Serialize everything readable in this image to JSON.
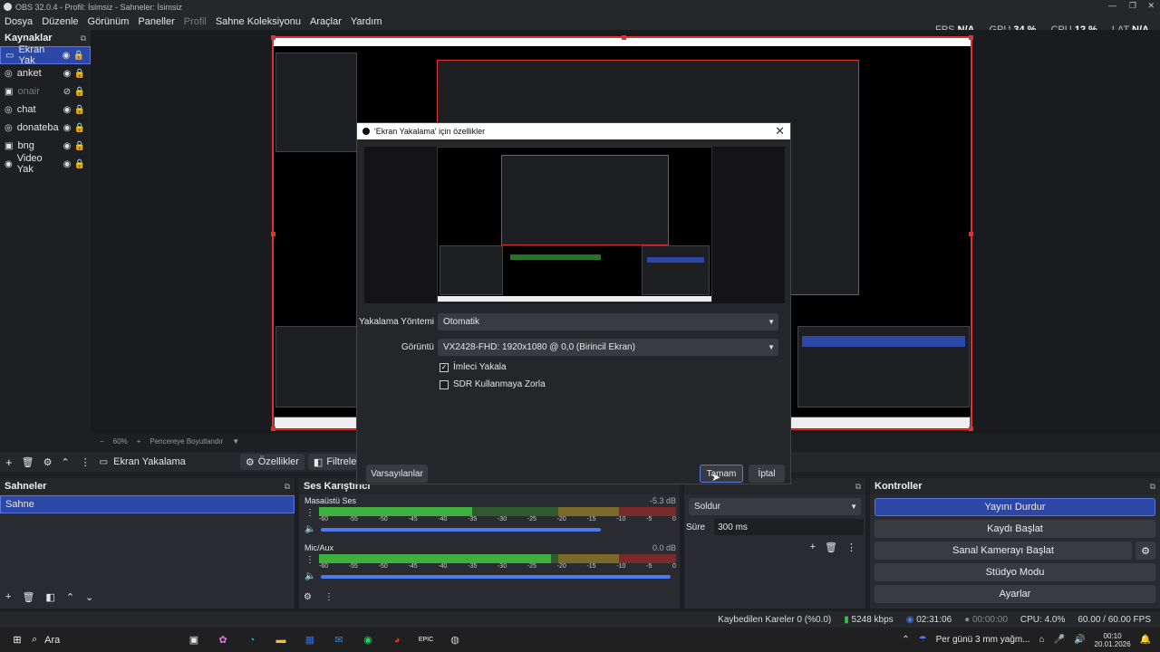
{
  "window": {
    "title": "OBS 32.0.4 - Profil: İsimsiz - Sahneler: İsimsiz"
  },
  "menu": [
    {
      "label": "Dosya",
      "disabled": false
    },
    {
      "label": "Düzenle",
      "disabled": false
    },
    {
      "label": "Görünüm",
      "disabled": false
    },
    {
      "label": "Paneller",
      "disabled": false
    },
    {
      "label": "Profil",
      "disabled": true
    },
    {
      "label": "Sahne Koleksiyonu",
      "disabled": false
    },
    {
      "label": "Araçlar",
      "disabled": false
    },
    {
      "label": "Yardım",
      "disabled": false
    }
  ],
  "stats": {
    "fps_label": "FPS",
    "fps": "N/A",
    "gpu_label": "GPU",
    "gpu": "34 %",
    "cpu_label": "CPU",
    "cpu": "12 %",
    "lat_label": "LAT",
    "lat": "N/A"
  },
  "sources": {
    "title": "Kaynaklar",
    "items": [
      {
        "label": "Ekran Yak",
        "icon": "monitor-icon",
        "visible": true,
        "selected": true
      },
      {
        "label": "anket",
        "icon": "browser-icon",
        "visible": true,
        "selected": false
      },
      {
        "label": "onair",
        "icon": "image-icon",
        "visible": false,
        "selected": false
      },
      {
        "label": "chat",
        "icon": "browser-icon",
        "visible": true,
        "selected": false
      },
      {
        "label": "donateba",
        "icon": "browser-icon",
        "visible": true,
        "selected": false
      },
      {
        "label": "bng",
        "icon": "image-icon",
        "visible": true,
        "selected": false
      },
      {
        "label": "Video Yak",
        "icon": "camera-icon",
        "visible": true,
        "selected": false
      }
    ]
  },
  "preview": {
    "zoom": "60%",
    "fit_label": "Pencereye Boyutlandır"
  },
  "source_toolbar": {
    "current": "Ekran Yakalama",
    "properties": "Özellikler",
    "filters": "Filtreler"
  },
  "scenes": {
    "title": "Sahneler",
    "items": [
      "Sahne"
    ]
  },
  "mixer": {
    "title": "Ses Karıştırıcı",
    "channels": [
      {
        "name": "Masaüstü Ses",
        "db": "-5.3 dB",
        "level": 0.43,
        "volume": 0.8
      },
      {
        "name": "Mic/Aux",
        "db": "0.0 dB",
        "level": 0.65,
        "volume": 1.0
      }
    ],
    "ticks": [
      "-60",
      "-55",
      "-50",
      "-45",
      "-40",
      "-35",
      "-30",
      "-25",
      "-20",
      "-15",
      "-10",
      "-5",
      "0"
    ]
  },
  "transitions": {
    "type": "Soldur",
    "duration_label": "Süre",
    "duration": "300 ms"
  },
  "controls": {
    "title": "Kontroller",
    "stream": "Yayını Durdur",
    "record": "Kaydı Başlat",
    "virtualcam": "Sanal Kamerayı Başlat",
    "studio": "Stüdyo Modu",
    "settings": "Ayarlar"
  },
  "statusbar": {
    "dropped": "Kaybedilen Kareler 0 (%0.0)",
    "bitrate": "5248 kbps",
    "stream_time": "02:31:06",
    "rec_time": "00:00:00",
    "cpu": "CPU: 4.0%",
    "fps": "60.00 / 60.00 FPS"
  },
  "dialog": {
    "title": "'Ekran Yakalama' için özellikler",
    "method_label": "Yakalama Yöntemi",
    "method": "Otomatik",
    "display_label": "Görüntü",
    "display": "VX2428-FHD: 1920x1080 @ 0,0 (Birincil Ekran)",
    "capture_cursor": "İmleci Yakala",
    "capture_cursor_checked": true,
    "sdr": "SDR Kullanmaya Zorla",
    "sdr_checked": false,
    "defaults": "Varsayılanlar",
    "ok": "Tamam",
    "cancel": "İptal"
  },
  "taskbar": {
    "search": "Ara",
    "weather": "Per günü 3 mm yağm...",
    "time": "00:10",
    "date": "20.01.2026"
  },
  "colors": {
    "accent": "#2d47a7",
    "capture_border": "#e03030",
    "meter_green": "#3fbf3f",
    "meter_yellow": "#bfae3f",
    "meter_red": "#bf3f3f"
  }
}
